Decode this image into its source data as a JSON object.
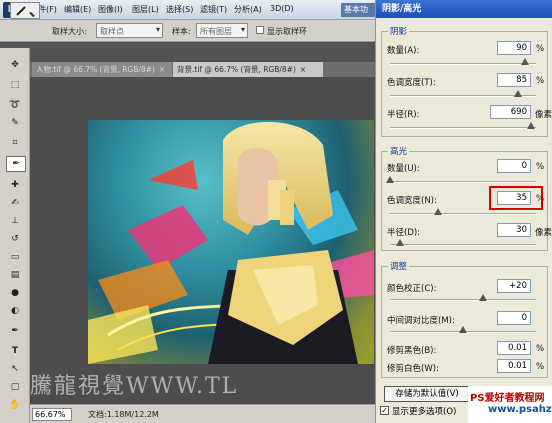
{
  "app": {
    "logo": "Ps"
  },
  "menu": [
    "文件(F)",
    "编辑(E)",
    "图像(I)",
    "图层(L)",
    "选择(S)",
    "滤镜(T)",
    "分析(A)",
    "3D(D)"
  ],
  "workspace_label": "基本功能",
  "options": {
    "sample_size_label": "取样大小:",
    "sample_size_value": "取样点",
    "sample_label": "样本:",
    "sample_value": "所有图层",
    "show_ring_label": "显示取样环"
  },
  "tabs": [
    {
      "title": "人物.tif @ 66.7% (背景, RGB/8#)",
      "close": "×"
    },
    {
      "title": "背景.tif @ 66.7% (背景, RGB/8#)",
      "close": "×"
    }
  ],
  "status": {
    "zoom": "66.67%",
    "doc": "文档:1.18M/12.2M"
  },
  "watermark": "騰龍視覺WWW.TL",
  "dialog": {
    "title": "阴影/高光",
    "shadows": {
      "title": "阴影",
      "amount": {
        "label": "数量(A):",
        "value": "90",
        "unit": "%"
      },
      "tonal": {
        "label": "色调宽度(T):",
        "value": "85",
        "unit": "%"
      },
      "radius": {
        "label": "半径(R):",
        "value": "690",
        "unit": "像素"
      }
    },
    "highlights": {
      "title": "高光",
      "amount": {
        "label": "数量(U):",
        "value": "0",
        "unit": "%"
      },
      "tonal": {
        "label": "色调宽度(N):",
        "value": "35",
        "unit": "%"
      },
      "radius": {
        "label": "半径(D):",
        "value": "30",
        "unit": "像素"
      }
    },
    "adjust": {
      "title": "调整",
      "color": {
        "label": "颜色校正(C):",
        "value": "+20"
      },
      "midtone": {
        "label": "中间调对比度(M):",
        "value": "0"
      },
      "clip_black": {
        "label": "修剪黑色(B):",
        "value": "0.01",
        "unit": "%"
      },
      "clip_white": {
        "label": "修剪白色(W):",
        "value": "0.01",
        "unit": "%"
      }
    },
    "save_defaults": "存储为默认值(V)",
    "show_more": "显示更多选项(O)"
  },
  "site_badge": {
    "name": "PS爱好者教程网",
    "url": "www.psahz.com"
  },
  "colors": {
    "title_bar": "#1a4fb8",
    "highlight_frame": "#d40000",
    "site_red": "#c00000",
    "site_blue": "#1450a0"
  }
}
